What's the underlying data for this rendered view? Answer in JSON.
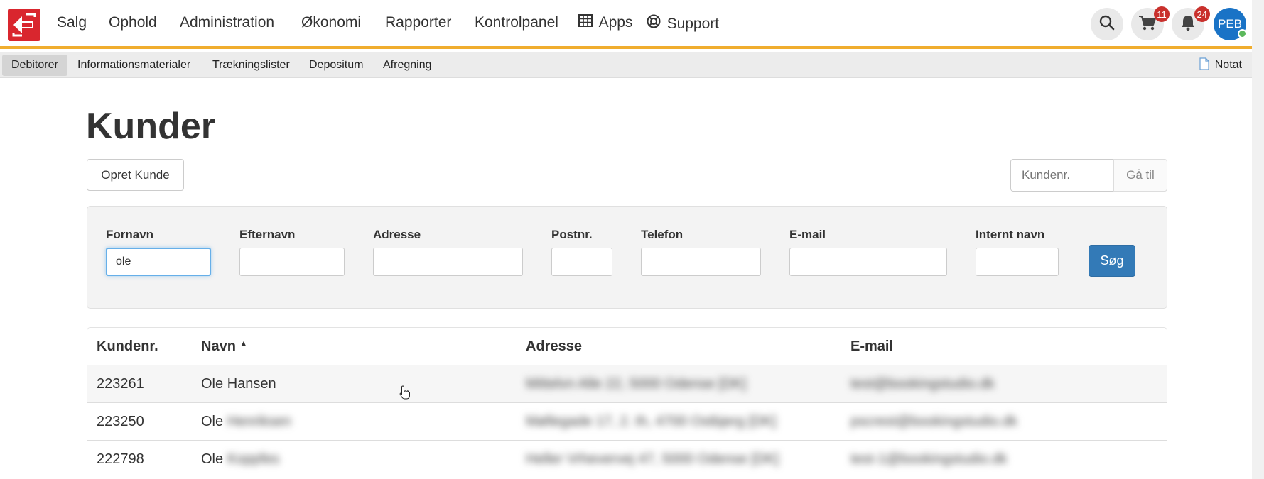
{
  "topnav": {
    "logo_icon": "booking-arrows-logo",
    "items": [
      {
        "label": "Salg"
      },
      {
        "label": "Ophold"
      },
      {
        "label": "Administration"
      },
      {
        "label": "Økonomi"
      },
      {
        "label": "Rapporter"
      },
      {
        "label": "Kontrolpanel"
      },
      {
        "label": "Apps",
        "icon": "grid-icon"
      },
      {
        "label": "Support",
        "icon": "lifebuoy-icon"
      }
    ],
    "cart_count": "11",
    "notification_count": "24",
    "avatar_initials": "PEB",
    "accent_color": "#f0ad2e"
  },
  "subnav": {
    "items": [
      {
        "label": "Debitorer",
        "active": true
      },
      {
        "label": "Informationsmaterialer"
      },
      {
        "label": "Trækningslister"
      },
      {
        "label": "Depositum"
      },
      {
        "label": "Afregning"
      }
    ],
    "note_label": "Notat"
  },
  "page": {
    "title": "Kunder",
    "create_button": "Opret Kunde",
    "goto_placeholder": "Kundenr.",
    "goto_button": "Gå til"
  },
  "search": {
    "fields": [
      {
        "label": "Fornavn",
        "value": "ole"
      },
      {
        "label": "Efternavn",
        "value": ""
      },
      {
        "label": "Adresse",
        "value": ""
      },
      {
        "label": "Postnr.",
        "value": ""
      },
      {
        "label": "Telefon",
        "value": ""
      },
      {
        "label": "E-mail",
        "value": ""
      },
      {
        "label": "Internt navn",
        "value": ""
      }
    ],
    "submit_label": "Søg",
    "submit_color": "#337ab7"
  },
  "table": {
    "columns": [
      "Kundenr.",
      "Navn",
      "Adresse",
      "E-mail"
    ],
    "sorted_column": "Navn",
    "rows": [
      {
        "id": "223261",
        "first": "Ole",
        "last": "Hansen",
        "address": "Mittelvn Alle 22, 5000 Odense [DK]",
        "email": "test@bookingstudio.dk"
      },
      {
        "id": "223250",
        "first": "Ole",
        "last": "Henriksen",
        "address": "Møllegade 17, 2. th, 4700 Ostbjerg [DK]",
        "email": "pscrest@bookingstudio.dk"
      },
      {
        "id": "222798",
        "first": "Ole",
        "last": "Koppfes",
        "address": "Heller Vrhevervej 47, 5000 Odense [DK]",
        "email": "test-1@bookingstudio.dk"
      }
    ]
  }
}
